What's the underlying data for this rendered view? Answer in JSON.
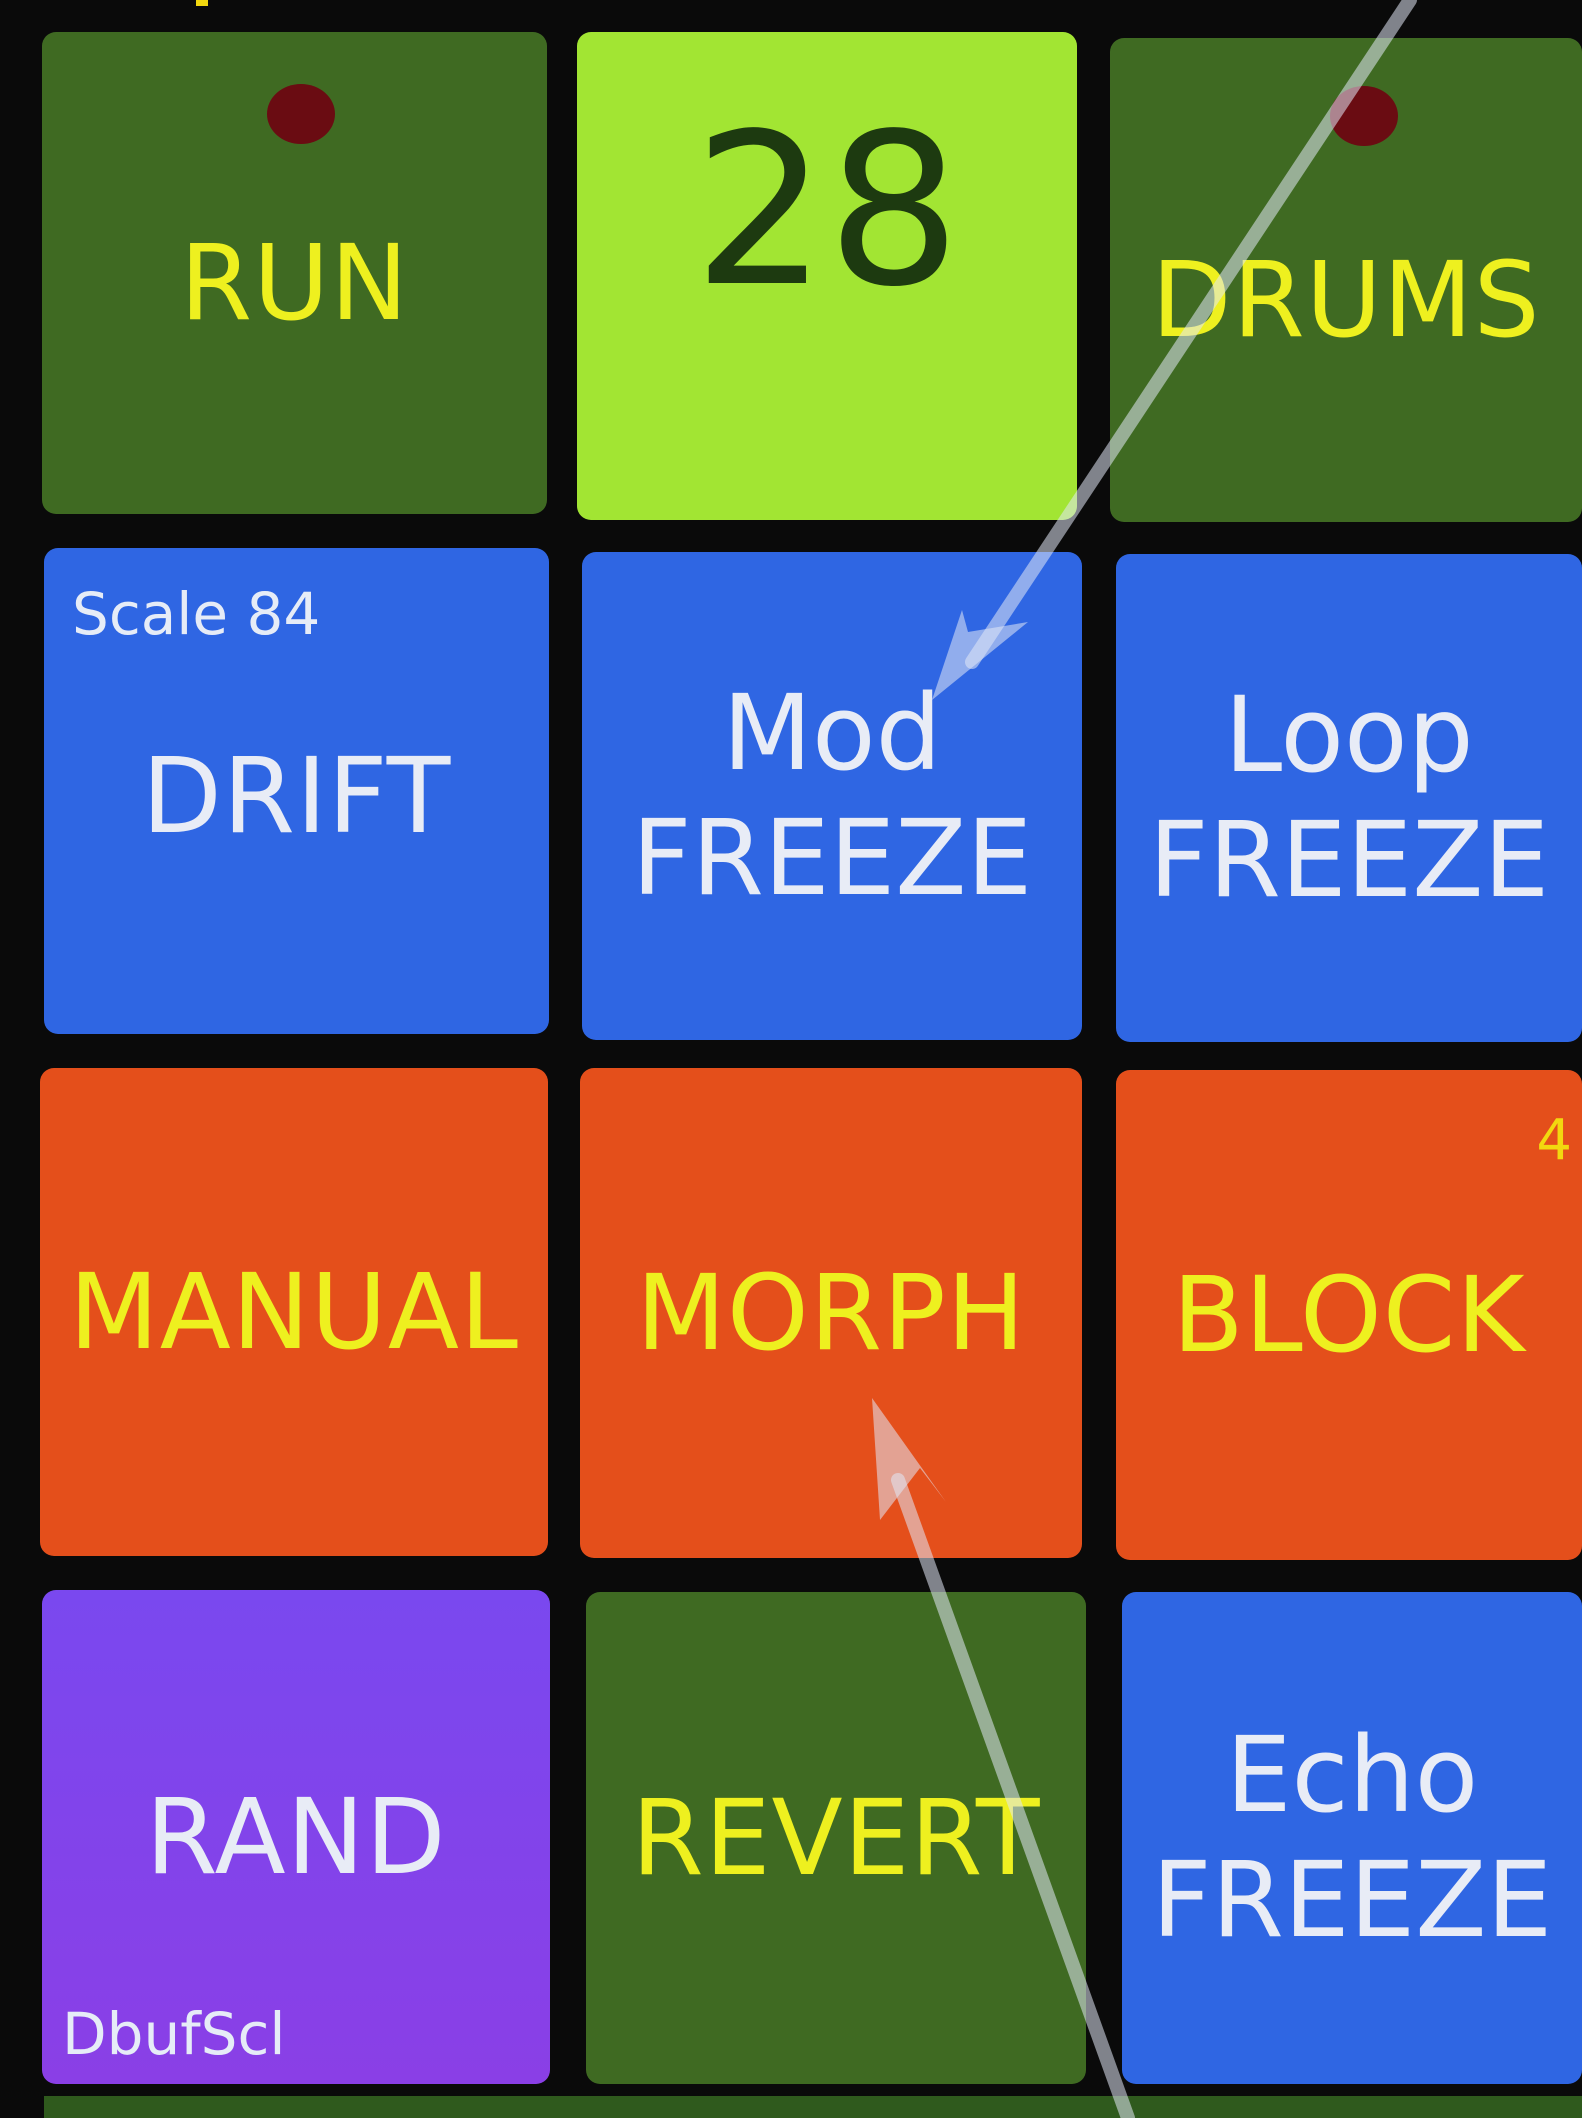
{
  "pads": {
    "run": "RUN",
    "counter": "28",
    "drums": "DRUMS",
    "drift": "DRIFT",
    "drift_scale": "Scale 84",
    "mod_freeze_top": "Mod",
    "mod_freeze_bottom": "FREEZE",
    "loop_freeze_top": "Loop",
    "loop_freeze_bottom": "FREEZE",
    "manual": "MANUAL",
    "morph": "MORPH",
    "block": "BLOCK",
    "block_digit": "4",
    "rand": "RAND",
    "rand_corner": "DbufScl",
    "revert": "REVERT",
    "echo_freeze_top": "Echo",
    "echo_freeze_bottom": "FREEZE"
  },
  "colors": {
    "green": "#3f6a22",
    "lime": "#a2e533",
    "blue": "#2f66e3",
    "orange": "#e44f1b",
    "purple": "#7a48ef",
    "yellow_text": "#eef01f",
    "led": "#6a0c12"
  }
}
